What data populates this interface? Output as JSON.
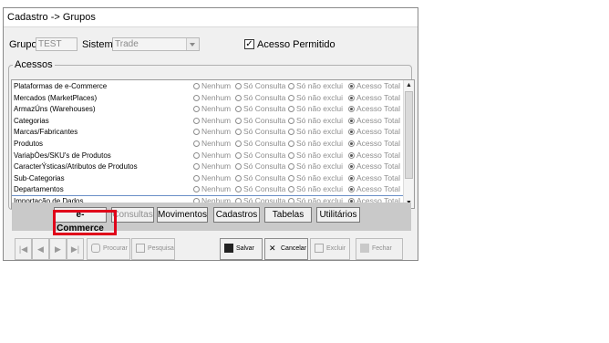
{
  "window": {
    "title": "Cadastro -> Grupos"
  },
  "form": {
    "grupo_label": "Grupo:",
    "grupo_value": "TEST",
    "sistema_label": "Sistema:",
    "sistema_value": "Trade",
    "acesso_permitido_label": "Acesso Permitido",
    "acesso_permitido_checked": true
  },
  "acessos": {
    "title": "Acessos",
    "options": [
      "Nenhum",
      "Só Consulta",
      "Só não exclui",
      "Acesso Total"
    ],
    "rows": [
      {
        "name": "Plataformas de e-Commerce",
        "selected": "Acesso Total"
      },
      {
        "name": "Mercados (MarketPlaces)",
        "selected": "Acesso Total"
      },
      {
        "name": "ArmazÚns (Warehouses)",
        "selected": "Acesso Total"
      },
      {
        "name": "Categorias",
        "selected": "Acesso Total"
      },
      {
        "name": "Marcas/Fabricantes",
        "selected": "Acesso Total"
      },
      {
        "name": "Produtos",
        "selected": "Acesso Total"
      },
      {
        "name": "VariaþÒes/SKU's de Produtos",
        "selected": "Acesso Total"
      },
      {
        "name": "CaracterÝsticas/Atributos de Produtos",
        "selected": "Acesso Total"
      },
      {
        "name": "Sub-Categorias",
        "selected": "Acesso Total"
      },
      {
        "name": "Departamentos",
        "selected": "Acesso Total"
      },
      {
        "name": "Importação de Dados",
        "selected": "Acesso Total"
      }
    ]
  },
  "tabs": [
    "e-Commerce",
    "Consultas",
    "Movimentos",
    "Cadastros",
    "Tabelas",
    "Utilitários"
  ],
  "active_tab": "e-Commerce",
  "toolbar": {
    "procurar": "Procurar",
    "pesquisa": "Pesquisa",
    "salvar": "Salvar",
    "cancelar": "Cancelar",
    "excluir": "Excluir",
    "fechar": "Fechar"
  },
  "colors": {
    "highlight": "#e0001a",
    "selection": "#6a8fc8"
  }
}
